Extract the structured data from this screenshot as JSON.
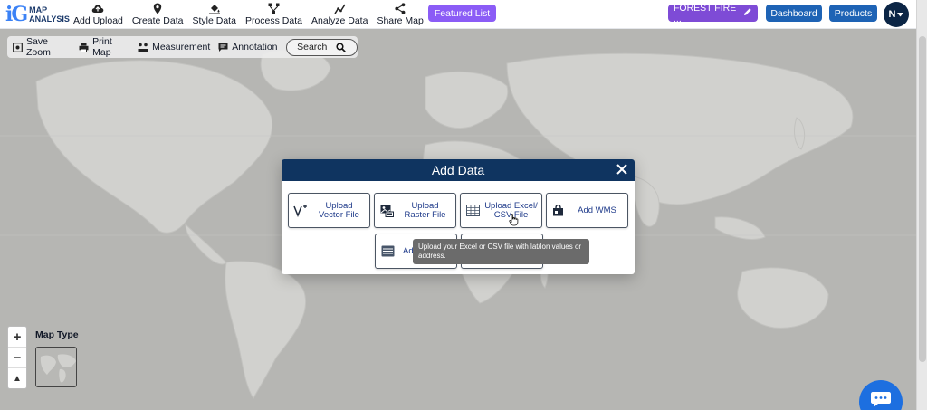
{
  "app": {
    "logo_letters": "iG",
    "logo_line1": "MAP",
    "logo_line2": "ANALYSIS"
  },
  "nav": {
    "items": [
      {
        "label": "Add Upload",
        "icon": "cloud-upload-icon"
      },
      {
        "label": "Create Data",
        "icon": "map-pin-icon"
      },
      {
        "label": "Style Data",
        "icon": "paint-bucket-icon"
      },
      {
        "label": "Process Data",
        "icon": "process-nodes-icon"
      },
      {
        "label": "Analyze Data",
        "icon": "analyze-chart-icon"
      },
      {
        "label": "Share Map",
        "icon": "share-icon"
      }
    ],
    "featured_label": "Featured List",
    "project_label": "FOREST FIRE ...",
    "dashboard_label": "Dashboard",
    "products_label": "Products",
    "avatar_initial": "N"
  },
  "toolbar": {
    "save_zoom": "Save Zoom",
    "print_map": "Print Map",
    "measurement": "Measurement",
    "annotation": "Annotation",
    "search": "Search"
  },
  "map": {
    "zoom_in": "+",
    "zoom_out": "−",
    "compass": "▲",
    "map_type_label": "Map Type"
  },
  "modal": {
    "title": "Add Data",
    "options": [
      {
        "label": "Upload Vector File",
        "icon": "vector-icon"
      },
      {
        "label": "Upload Raster File",
        "icon": "raster-image-icon"
      },
      {
        "label": "Upload Excel/ CSV File",
        "icon": "table-icon"
      },
      {
        "label": "Add WMS",
        "icon": "wms-layer-icon"
      },
      {
        "label": "Ad",
        "icon": "database-icon"
      },
      {
        "label": "",
        "icon": "layer-icon"
      }
    ],
    "tooltip": "Upload your Excel or CSV file with lat/lon values or address."
  },
  "colors": {
    "modal_header": "#0f3460",
    "featured": "#8b5cf6",
    "project": "#7e4bd6",
    "nav_button": "#1e63b5",
    "chat": "#1d6fe0"
  }
}
